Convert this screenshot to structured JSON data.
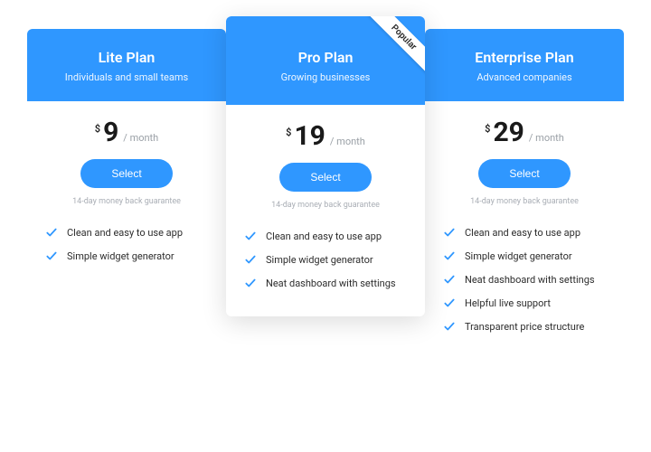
{
  "popular_label": "Popular",
  "select_label": "Select",
  "guarantee": "14-day money back guarantee",
  "currency": "$",
  "period": "/ month",
  "plans": [
    {
      "name": "Lite Plan",
      "subtitle": "Individuals and small teams",
      "price": "9",
      "featured": false,
      "features": [
        "Clean and easy to use app",
        "Simple widget generator"
      ]
    },
    {
      "name": "Pro Plan",
      "subtitle": "Growing businesses",
      "price": "19",
      "featured": true,
      "features": [
        "Clean and easy to use app",
        "Simple widget generator",
        "Neat dashboard with settings"
      ]
    },
    {
      "name": "Enterprise Plan",
      "subtitle": "Advanced companies",
      "price": "29",
      "featured": false,
      "features": [
        "Clean and easy to use app",
        "Simple widget generator",
        "Neat dashboard with settings",
        "Helpful live support",
        "Transparent price structure"
      ]
    }
  ]
}
